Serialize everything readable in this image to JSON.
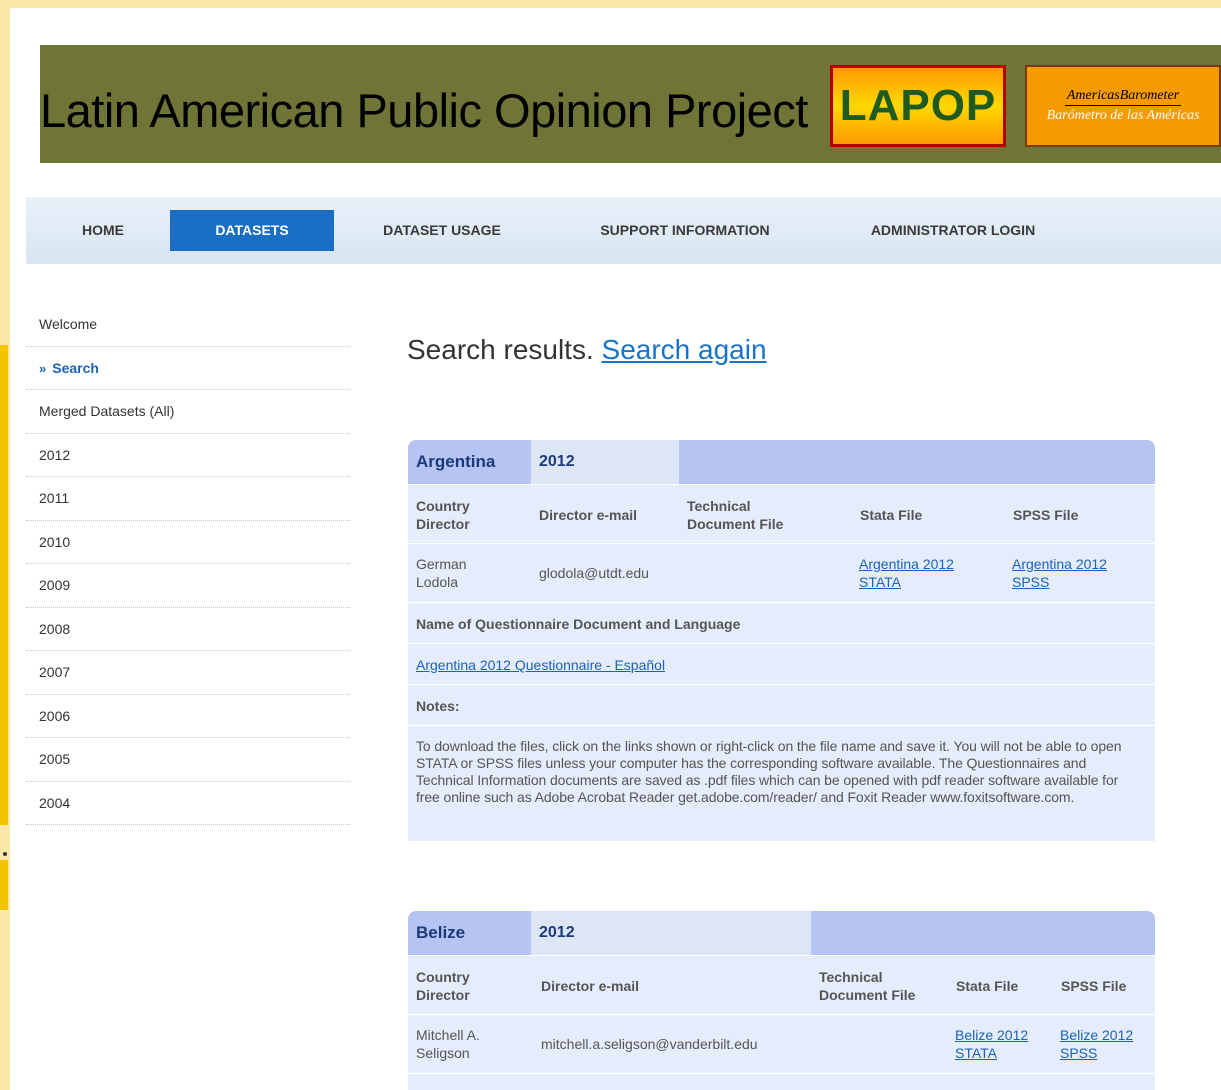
{
  "header": {
    "title": "Latin American Public Opinion Project",
    "logo_lapop": "LAPOP",
    "logo_americas_line1": "AmericasBarometer",
    "logo_americas_line2": "Barómetro de las Américas"
  },
  "nav": {
    "home": "HOME",
    "datasets": "DATASETS",
    "usage": "DATASET USAGE",
    "support": "SUPPORT INFORMATION",
    "admin": "ADMINISTRATOR LOGIN"
  },
  "sidebar": {
    "items": [
      "Welcome",
      "Search",
      "Merged Datasets (All)",
      "2012",
      "2011",
      "2010",
      "2009",
      "2008",
      "2007",
      "2006",
      "2005",
      "2004"
    ]
  },
  "main": {
    "heading": "Search results.",
    "search_again": "Search again"
  },
  "columns": {
    "director": "Country Director",
    "email": "Director e-mail",
    "tech": "Technical Document File",
    "stata": "Stata File",
    "spss": "SPSS File",
    "questionnaire_header": "Name of Questionnaire Document and Language",
    "notes_header": "Notes:"
  },
  "results": [
    {
      "country": "Argentina",
      "year": "2012",
      "director": "German Lodola",
      "email": "glodola@utdt.edu",
      "stata": "Argentina 2012 STATA",
      "spss": "Argentina 2012 SPSS",
      "questionnaire": "Argentina 2012 Questionnaire - Español",
      "notes": "To download the files, click on the links shown or right-click on the file name and save it. You will not be able to open STATA or SPSS files unless your computer has the corresponding software available. The Questionnaires and Technical Information documents are saved as .pdf files which can be opened with pdf reader software available for free online such as Adobe Acrobat Reader get.adobe.com/reader/ and Foxit Reader www.foxitsoftware.com."
    },
    {
      "country": "Belize",
      "year": "2012",
      "director": "Mitchell A. Seligson",
      "email": "mitchell.a.seligson@vanderbilt.edu",
      "stata": "Belize 2012 STATA",
      "spss": "Belize 2012 SPSS"
    }
  ]
}
